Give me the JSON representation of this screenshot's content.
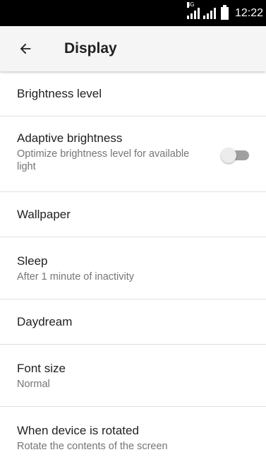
{
  "status_bar": {
    "network_type": "4G",
    "time": "12:22"
  },
  "app_bar": {
    "title": "Display",
    "back_icon": "arrow-back-icon"
  },
  "settings": [
    {
      "title": "Brightness level",
      "summary": ""
    },
    {
      "title": "Adaptive brightness",
      "summary": "Optimize brightness level for available light",
      "toggle": {
        "on": false
      }
    },
    {
      "title": "Wallpaper",
      "summary": ""
    },
    {
      "title": "Sleep",
      "summary": "After 1 minute of inactivity"
    },
    {
      "title": "Daydream",
      "summary": ""
    },
    {
      "title": "Font size",
      "summary": "Normal"
    },
    {
      "title": "When device is rotated",
      "summary": "Rotate the contents of the screen"
    }
  ],
  "colors": {
    "status_bar_bg": "#000000",
    "app_bar_bg": "#f5f5f5",
    "primary_text": "#212121",
    "secondary_text": "#757575",
    "divider": "#e0e0e0",
    "toggle_track_off": "#a0a0a0",
    "toggle_thumb_off": "#ececec"
  }
}
